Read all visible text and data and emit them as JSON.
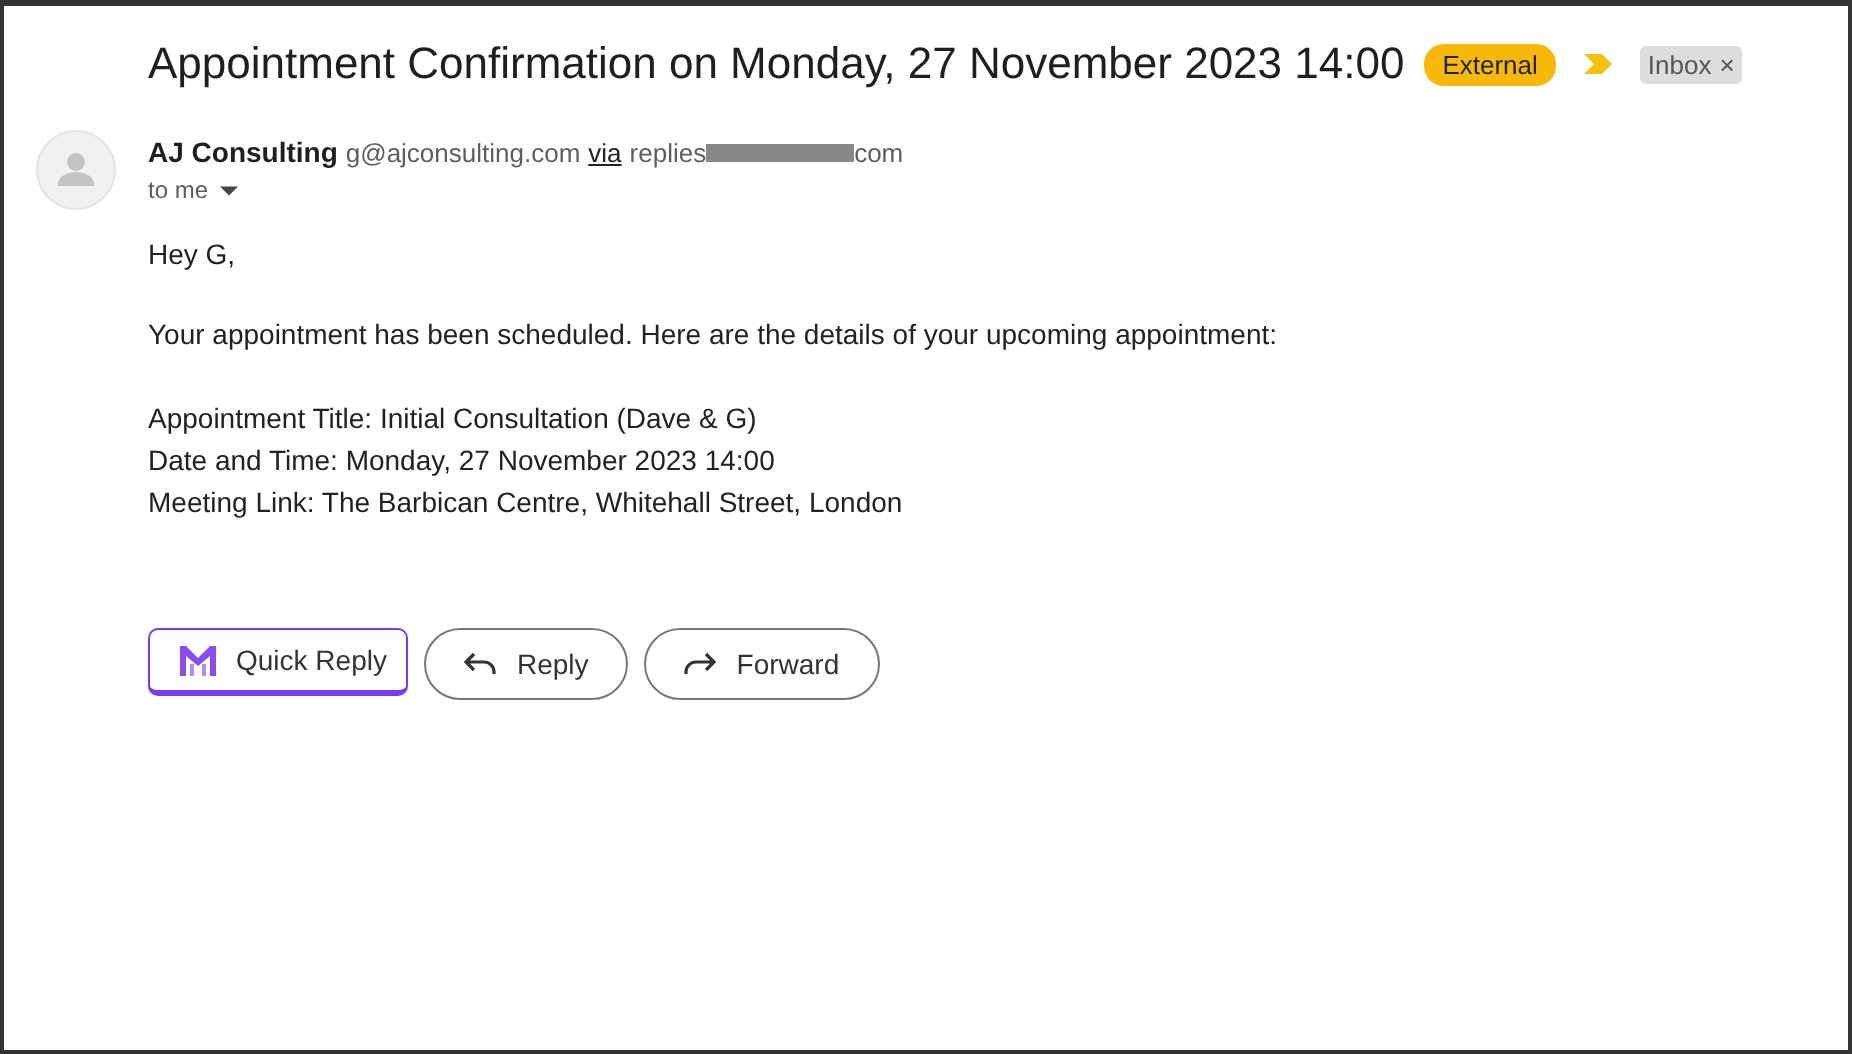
{
  "subject": "Appointment Confirmation on Monday, 27 November 2023 14:00",
  "labels": [
    {
      "text": "External",
      "kind": "warning"
    },
    {
      "text": "Inbox",
      "kind": "removable",
      "remove": "×"
    }
  ],
  "sender": {
    "name": "AJ Consulting",
    "email": "g@ajconsulting.com",
    "via": "via",
    "relay_start": "replies",
    "relay_end": "com",
    "recipient": "to me"
  },
  "body": [
    "Hey G,",
    "Your appointment has been scheduled. Here are the details of your upcoming appointment:",
    [
      "Appointment Title: Initial Consultation (Dave & G)",
      "Date and Time: Monday, 27 November 2023 14:00",
      "Meeting Link: The Barbican Centre, Whitehall Street, London"
    ]
  ],
  "actions": [
    {
      "label": "Quick Reply",
      "kind": "quick"
    },
    {
      "label": "Reply",
      "kind": "reply"
    },
    {
      "label": "Forward",
      "kind": "forward"
    }
  ]
}
